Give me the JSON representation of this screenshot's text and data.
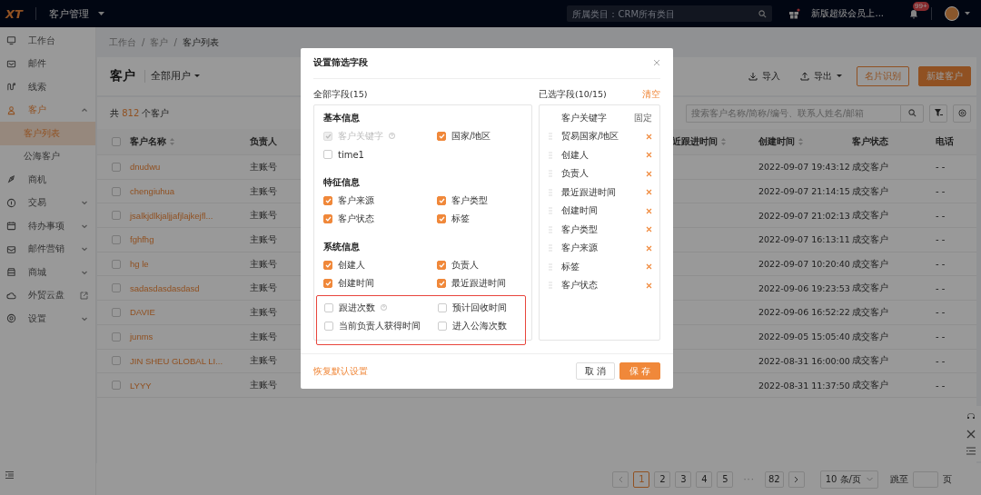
{
  "topbar": {
    "logo": "XT",
    "app_title": "客户管理",
    "search": {
      "placeholder": "所属类目：CRM所有类目"
    },
    "promo": "新版超级会员上...",
    "notification_badge": "99+"
  },
  "sidebar": {
    "items": [
      {
        "label": "工作台",
        "kind": "link"
      },
      {
        "label": "邮件",
        "kind": "link"
      },
      {
        "label": "线索",
        "kind": "link"
      },
      {
        "label": "客户",
        "kind": "group",
        "expanded": true,
        "active": true,
        "children": [
          {
            "label": "客户列表",
            "selected": true
          },
          {
            "label": "公海客户",
            "selected": false
          }
        ]
      },
      {
        "label": "商机",
        "kind": "link"
      },
      {
        "label": "交易",
        "kind": "group",
        "expanded": false,
        "active": false
      },
      {
        "label": "待办事项",
        "kind": "group",
        "expanded": false,
        "active": false
      },
      {
        "label": "邮件营销",
        "kind": "group",
        "expanded": false,
        "active": false
      },
      {
        "label": "商城",
        "kind": "group",
        "expanded": false,
        "active": false
      },
      {
        "label": "外贸云盘",
        "kind": "external"
      },
      {
        "label": "设置",
        "kind": "group",
        "expanded": false,
        "active": false
      }
    ]
  },
  "breadcrumb": [
    {
      "label": "工作台",
      "kind": "link"
    },
    {
      "label": "/",
      "kind": "separator"
    },
    {
      "label": "客户",
      "kind": "link"
    },
    {
      "label": "/",
      "kind": "separator"
    },
    {
      "label": "客户列表",
      "kind": "current"
    }
  ],
  "page_header": {
    "title": "客户",
    "view": "全部用户",
    "actions": [
      {
        "label": "导入",
        "kind": "import"
      },
      {
        "label": "导出",
        "kind": "export"
      },
      {
        "label": "名片识别",
        "kind": "outline"
      },
      {
        "label": "新建客户",
        "kind": "primary"
      }
    ]
  },
  "summary": {
    "prefix": "共",
    "count": "812",
    "suffix": "个客户"
  },
  "list_search": {
    "placeholder": "搜索客户名称/简称/编号、联系人姓名/邮箱"
  },
  "table": {
    "all_checked": false,
    "columns": [
      {
        "label": "客户名称",
        "sortable": true
      },
      {
        "label": "负责人",
        "sortable": false
      },
      {
        "label": "近跟进时间",
        "sortable": true
      },
      {
        "label": "创建时间",
        "sortable": true
      },
      {
        "label": "客户状态",
        "sortable": false
      },
      {
        "label": "电话",
        "sortable": false
      }
    ],
    "rows": [
      {
        "checked": false,
        "name": "dnudwu",
        "owner": "主账号",
        "created": "2022-09-07 19:43:12",
        "status": "成交客户",
        "phone": "- -"
      },
      {
        "checked": false,
        "name": "chengiuhua",
        "owner": "主账号",
        "created": "2022-09-07 21:14:15",
        "status": "成交客户",
        "phone": "- -"
      },
      {
        "checked": false,
        "name": "jsalkjdlkjaljjafjlajkejfl...",
        "owner": "主账号",
        "created": "2022-09-07 21:02:13",
        "status": "成交客户",
        "phone": "- -"
      },
      {
        "checked": false,
        "name": "fghfhg",
        "owner": "主账号",
        "created": "2022-09-07 16:13:11",
        "status": "成交客户",
        "phone": "- -"
      },
      {
        "checked": false,
        "name": "hg le",
        "owner": "主账号",
        "created": "2022-09-07 10:20:40",
        "status": "成交客户",
        "phone": "- -"
      },
      {
        "checked": false,
        "name": "sadasdasdasdasd",
        "owner": "主账号",
        "created": "2022-09-06 19:23:53",
        "status": "成交客户",
        "phone": "- -"
      },
      {
        "checked": false,
        "name": "DAVIE",
        "owner": "主账号",
        "created": "2022-09-06 16:52:22",
        "status": "成交客户",
        "phone": "- -"
      },
      {
        "checked": false,
        "name": "junms",
        "owner": "主账号",
        "created": "2022-09-05 15:05:40",
        "status": "成交客户",
        "phone": "- -"
      },
      {
        "checked": false,
        "name": "JIN SHEU GLOBAL LI...",
        "owner": "主账号",
        "created": "2022-08-31 16:00:00",
        "status": "成交客户",
        "phone": "- -"
      },
      {
        "checked": false,
        "name": "LYYY",
        "owner": "主账号",
        "created": "2022-08-31 11:37:50",
        "status": "成交客户",
        "phone": "- -"
      }
    ]
  },
  "pagination": {
    "pages": [
      {
        "label": "1",
        "kind": "page",
        "selected": true
      },
      {
        "label": "2",
        "kind": "page",
        "selected": false
      },
      {
        "label": "3",
        "kind": "page",
        "selected": false
      },
      {
        "label": "4",
        "kind": "page",
        "selected": false
      },
      {
        "label": "5",
        "kind": "page",
        "selected": false
      },
      {
        "label": "···",
        "kind": "ellipsis"
      },
      {
        "label": "82",
        "kind": "page",
        "selected": false
      }
    ],
    "page_size": "10 条/页",
    "jump_label": "跳至",
    "jump_suffix": "页"
  },
  "dialog": {
    "title": "设置筛选字段",
    "all_fields_label": "全部字段(15)",
    "selected_fields_label": "已选字段(10/15)",
    "clear_link": "清空",
    "sections": [
      {
        "title": "基本信息",
        "fields": [
          {
            "label": "客户关键字",
            "checked": true,
            "disabled": true,
            "help": true
          },
          {
            "label": "国家/地区",
            "checked": true,
            "disabled": false,
            "help": false
          },
          {
            "label": "time1",
            "checked": false,
            "disabled": false,
            "help": false
          }
        ]
      },
      {
        "title": "特征信息",
        "fields": [
          {
            "label": "客户来源",
            "checked": true,
            "disabled": false,
            "help": false
          },
          {
            "label": "客户类型",
            "checked": true,
            "disabled": false,
            "help": false
          },
          {
            "label": "客户状态",
            "checked": true,
            "disabled": false,
            "help": false
          },
          {
            "label": "标签",
            "checked": true,
            "disabled": false,
            "help": false
          }
        ]
      },
      {
        "title": "系统信息",
        "fields": [
          {
            "label": "创建人",
            "checked": true,
            "disabled": false,
            "help": false
          },
          {
            "label": "负责人",
            "checked": true,
            "disabled": false,
            "help": false
          },
          {
            "label": "创建时间",
            "checked": true,
            "disabled": false,
            "help": false
          },
          {
            "label": "最近跟进时间",
            "checked": true,
            "disabled": false,
            "help": false
          }
        ],
        "highlighted_fields": [
          {
            "label": "跟进次数",
            "checked": false,
            "disabled": false,
            "help": true
          },
          {
            "label": "预计回收时间",
            "checked": false,
            "disabled": false,
            "help": false
          },
          {
            "label": "当前负责人获得时间",
            "checked": false,
            "disabled": false,
            "help": false
          },
          {
            "label": "进入公海次数",
            "checked": false,
            "disabled": false,
            "help": false
          }
        ]
      }
    ],
    "selected_fields": [
      {
        "label": "客户关键字",
        "kind": "fixed",
        "note": "固定"
      },
      {
        "label": "贸易国家/地区",
        "kind": "removable"
      },
      {
        "label": "创建人",
        "kind": "removable"
      },
      {
        "label": "负责人",
        "kind": "removable"
      },
      {
        "label": "最近跟进时间",
        "kind": "removable"
      },
      {
        "label": "创建时间",
        "kind": "removable"
      },
      {
        "label": "客户类型",
        "kind": "removable"
      },
      {
        "label": "客户来源",
        "kind": "removable"
      },
      {
        "label": "标签",
        "kind": "removable"
      },
      {
        "label": "客户状态",
        "kind": "removable"
      }
    ],
    "reset_link": "恢复默认设置",
    "cancel_button": "取 消",
    "save_button": "保 存"
  }
}
